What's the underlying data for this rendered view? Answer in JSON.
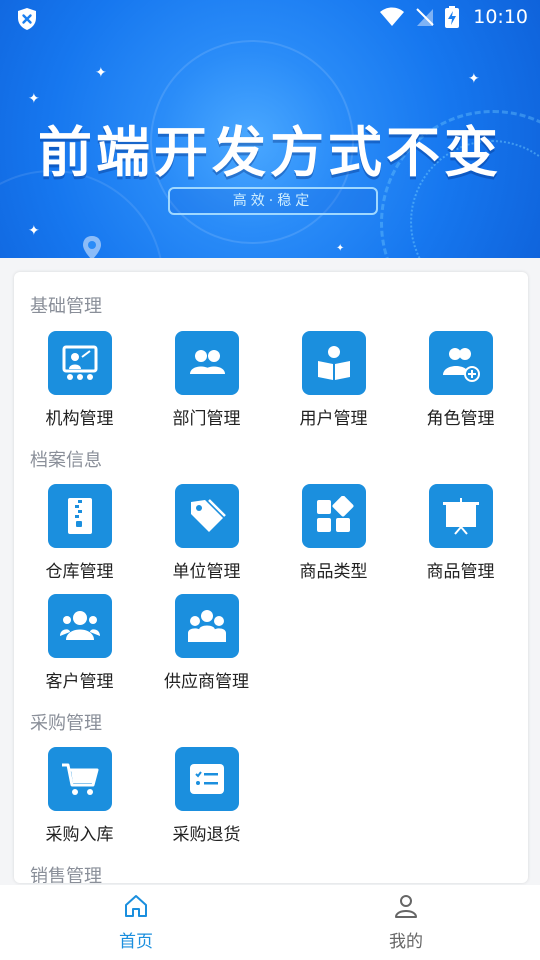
{
  "status_bar": {
    "time": "10:10"
  },
  "banner": {
    "title": "前端开发方式不变",
    "subtitle": "高效·稳定"
  },
  "sections": [
    {
      "title": "基础管理",
      "items": [
        {
          "label": "机构管理",
          "icon": "presentation-icon"
        },
        {
          "label": "部门管理",
          "icon": "group-icon"
        },
        {
          "label": "用户管理",
          "icon": "user-book-icon"
        },
        {
          "label": "角色管理",
          "icon": "user-add-icon"
        }
      ]
    },
    {
      "title": "档案信息",
      "items": [
        {
          "label": "仓库管理",
          "icon": "zip-archive-icon"
        },
        {
          "label": "单位管理",
          "icon": "tags-icon"
        },
        {
          "label": "商品类型",
          "icon": "category-grid-icon"
        },
        {
          "label": "商品管理",
          "icon": "display-board-icon"
        },
        {
          "label": "客户管理",
          "icon": "customers-icon"
        },
        {
          "label": "供应商管理",
          "icon": "suppliers-icon"
        }
      ]
    },
    {
      "title": "采购管理",
      "items": [
        {
          "label": "采购入库",
          "icon": "cart-icon"
        },
        {
          "label": "采购退货",
          "icon": "list-card-icon"
        }
      ]
    },
    {
      "title": "销售管理",
      "items": []
    }
  ],
  "tabbar": {
    "tabs": [
      {
        "label": "首页",
        "icon": "home-icon",
        "active": true
      },
      {
        "label": "我的",
        "icon": "person-icon",
        "active": false
      }
    ],
    "active_color": "#1b8fde",
    "inactive_color": "#666666"
  },
  "colors": {
    "accent": "#1b8fde",
    "banner": "#1677ef"
  }
}
